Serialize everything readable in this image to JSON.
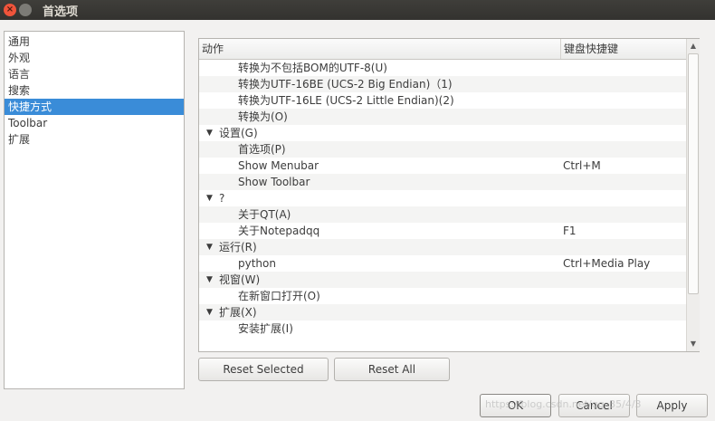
{
  "window": {
    "title": "首选项",
    "close_glyph": "×"
  },
  "categories": [
    {
      "label": "通用"
    },
    {
      "label": "外观"
    },
    {
      "label": "语言"
    },
    {
      "label": "搜索"
    },
    {
      "label": "快捷方式",
      "selected": true
    },
    {
      "label": "Toolbar"
    },
    {
      "label": "扩展"
    }
  ],
  "table": {
    "header_action": "动作",
    "header_shortcut": "键盘快捷键",
    "expand_glyph": "▼",
    "rows": [
      {
        "type": "child",
        "action": "转换为不包括BOM的UTF-8(U)",
        "shortcut": ""
      },
      {
        "type": "child",
        "action": "转换为UTF-16BE (UCS-2 Big Endian)（1)",
        "shortcut": ""
      },
      {
        "type": "child",
        "action": "转换为UTF-16LE (UCS-2 Little Endian)(2)",
        "shortcut": ""
      },
      {
        "type": "child",
        "action": "转换为(O)",
        "shortcut": ""
      },
      {
        "type": "group",
        "action": "设置(G)",
        "shortcut": ""
      },
      {
        "type": "child",
        "action": "首选项(P)",
        "shortcut": ""
      },
      {
        "type": "child",
        "action": "Show Menubar",
        "shortcut": "Ctrl+M"
      },
      {
        "type": "child",
        "action": "Show Toolbar",
        "shortcut": ""
      },
      {
        "type": "group",
        "action": "?",
        "shortcut": ""
      },
      {
        "type": "child",
        "action": "关于QT(A)",
        "shortcut": ""
      },
      {
        "type": "child",
        "action": "关于Notepadqq",
        "shortcut": "F1"
      },
      {
        "type": "group",
        "action": "运行(R)",
        "shortcut": ""
      },
      {
        "type": "child",
        "action": "python",
        "shortcut": "Ctrl+Media Play"
      },
      {
        "type": "group",
        "action": "视窗(W)",
        "shortcut": ""
      },
      {
        "type": "child",
        "action": "在新窗口打开(O)",
        "shortcut": ""
      },
      {
        "type": "group",
        "action": "扩展(X)",
        "shortcut": ""
      },
      {
        "type": "child",
        "action": "安装扩展(I)",
        "shortcut": ""
      }
    ],
    "scroll_up_glyph": "▲",
    "scroll_down_glyph": "▼"
  },
  "buttons": {
    "reset_selected": "Reset Selected",
    "reset_all": "Reset All",
    "ok": "OK",
    "cancel": "Cancel",
    "apply": "Apply"
  },
  "watermark": "https://blog.csdn.net/qq_35/4/3"
}
